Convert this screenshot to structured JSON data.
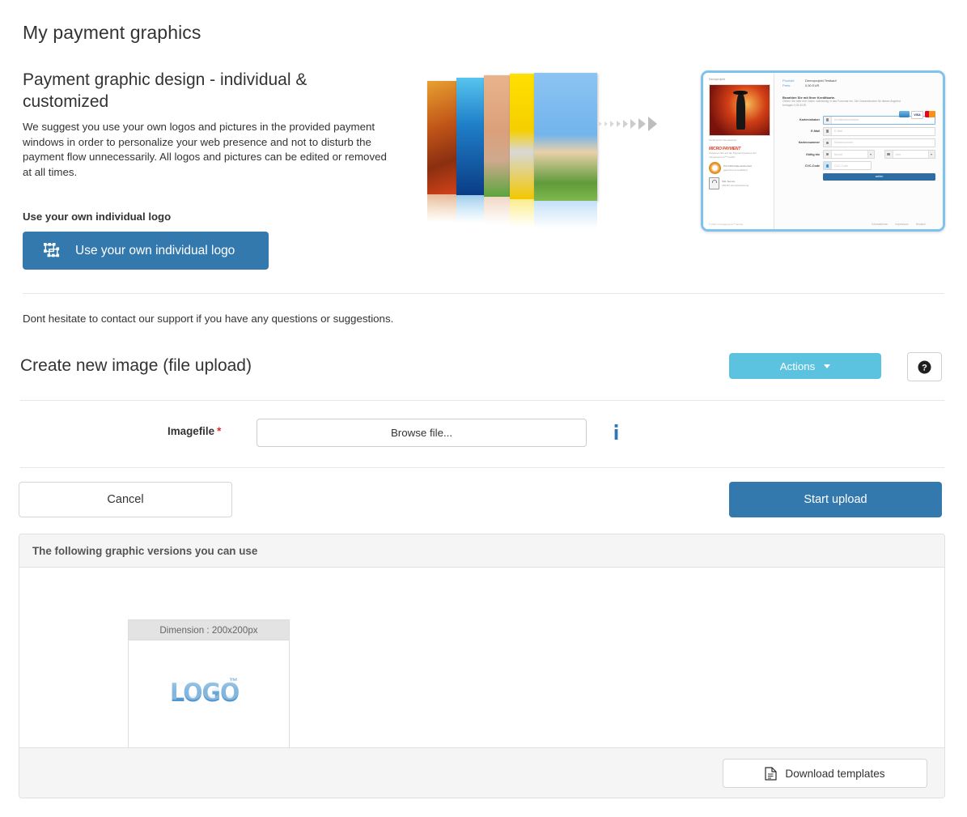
{
  "page": {
    "title": "My payment graphics"
  },
  "intro": {
    "heading": "Payment graphic design - individual & customized",
    "body": "We suggest you use your own logos and pictures in the provided payment windows in order to personalize your web presence and not to disturb the payment flow unnecessarily. All logos and pictures can be edited or removed at all times.",
    "logo_label": "Use your own individual logo",
    "logo_button": "Use your own individual logo",
    "logo_button_icon": "selection-transform-icon",
    "support_note": "Dont hesitate to contact our support if you have any questions or suggestions."
  },
  "hero": {
    "card_colors": [
      "#c8611f",
      "#1463b4",
      "#e8a07a",
      "#f5d000",
      "#7fb8ec"
    ],
    "arrow_color": "#c9c9c9"
  },
  "payment_window": {
    "frame_color": "#7ec2ee",
    "shop_name": "Demoprojekt",
    "product_caption": "Technischer Dienstleister:",
    "brand_prefix": "MICRO",
    "brand_suffix": "PAYMENT",
    "brand_tagline": "Vertrauen Sie auf die Paymentsysteme der micropayment™ GmbH",
    "badges": [
      {
        "title": "PCI-DSS Datensicherheit",
        "sub": "geprüft und zertifiziert"
      },
      {
        "title": "SSL Secure",
        "sub": "256-Bit Verschlüsselung"
      }
    ],
    "copyright": "© 2017 micropayment™ GmbH",
    "summary": [
      {
        "key": "Produkt:",
        "value": "Demoprojekt Testkauf"
      },
      {
        "key": "Preis:",
        "value": "0,50 EUR"
      }
    ],
    "pay_heading": "Bezahlen Sie mit Ihrer Kreditkarte.",
    "pay_text": "Geben Sie bitte Ihre Daten vollständig in das Formular ein. Die Gesamtkosten für dieses Angebot betragen 0,50 EUR.",
    "card_brands": [
      "amex-icon",
      "VISA",
      "mastercard-icon"
    ],
    "fields": [
      {
        "label": "Karteninhaber",
        "placeholder": "Kreditkarteninhaber",
        "icon": "user-icon"
      },
      {
        "label": "E-Mail",
        "placeholder": "E-Mail",
        "icon": "mail-icon"
      },
      {
        "label": "Kartennummer",
        "placeholder": "Kartennummer",
        "icon": "card-icon"
      }
    ],
    "expiry_label": "Gültig bis",
    "expiry_month": "Monat",
    "expiry_year": "Jahr",
    "cvc_label": "CVC-Code",
    "cvc_placeholder": "CVC-Code",
    "submit": "weiter",
    "footer_links": [
      "Informationen",
      "Impressum",
      "Deutsch"
    ]
  },
  "upload": {
    "heading": "Create new image (file upload)",
    "actions_label": "Actions",
    "actions_color": "#5bc3e0",
    "help_icon": "question-mark-circle-icon",
    "field_label": "Imagefile",
    "required_marker": "*",
    "browse_label": "Browse file...",
    "info_icon": "info-icon",
    "cancel_label": "Cancel",
    "start_upload_label": "Start upload",
    "start_upload_color": "#3479ad"
  },
  "versions_panel": {
    "header": "The following graphic versions you can use",
    "thumbnail": {
      "caption": "Dimension : 200x200px",
      "logo_text": "LOGO",
      "trademark": "™"
    },
    "download_label": "Download templates",
    "download_icon": "file-document-icon"
  }
}
